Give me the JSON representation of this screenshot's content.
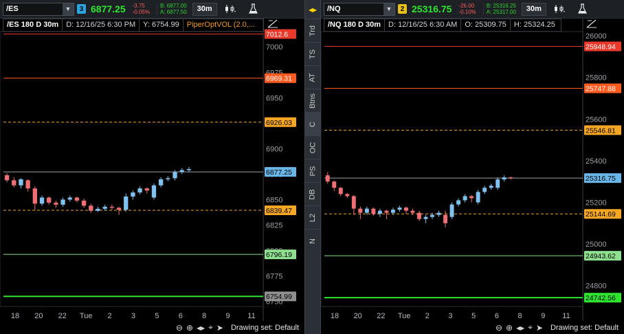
{
  "side_strip": {
    "tabs": [
      "Trd",
      "TS",
      "AT",
      "Btns",
      "C",
      "OC",
      "PS",
      "DB",
      "L2",
      "N"
    ]
  },
  "charts": [
    {
      "symbol": "/ES",
      "link_number": "3",
      "link_color": "#2aa7e0",
      "last": "6877.25",
      "net_change": "-3.75",
      "net_change_pct": "-0.05%",
      "bid": "B: 6877.00",
      "ask": "A: 6877.50",
      "timeframe": "30m",
      "info": {
        "symbol_period": "/ES 180 D 30m",
        "date": "D: 12/16/25 6:30 PM",
        "field": "Y: 6754.99",
        "study": "PiperOptVOL (2.0,..."
      },
      "axis_ticks": [
        "7000",
        "6975",
        "6950",
        "6925",
        "6900",
        "6875",
        "6850",
        "6825",
        "6800",
        "6775",
        "6750"
      ],
      "price_labels": [
        {
          "text": "7012.6",
          "bg": "#e8392b",
          "fg": "#ffffff"
        },
        {
          "text": "6969.31",
          "bg": "#ff5a1f",
          "fg": "#ffffff"
        },
        {
          "text": "6926.03",
          "bg": "#f5a623",
          "fg": "#000000"
        },
        {
          "text": "6877.25",
          "bg": "#6ab6e8",
          "fg": "#000000"
        },
        {
          "text": "6839.47",
          "bg": "#f5a623",
          "fg": "#000000"
        },
        {
          "text": "6796.19",
          "bg": "#8ee08e",
          "fg": "#000000"
        },
        {
          "text": "6754.99",
          "bg": "#8f8f8f",
          "fg": "#000000"
        }
      ],
      "x_labels": [
        "18",
        "20",
        "22",
        "Tue",
        "2",
        "3",
        "5",
        "6",
        "8",
        "9",
        "11"
      ],
      "drawing_set": "Drawing set: Default"
    },
    {
      "symbol": "/NQ",
      "link_number": "2",
      "link_color": "#e8c21a",
      "last": "25316.75",
      "net_change": "-26.00",
      "net_change_pct": "-0.10%",
      "bid": "B: 25316.25",
      "ask": "A: 25317.00",
      "timeframe": "30m",
      "info": {
        "symbol_period": "/NQ 180 D 30m",
        "date": "D: 12/16/25 6:30 AM",
        "field": "O: 25309.75",
        "study": "H: 25324.25"
      },
      "axis_ticks": [
        "26000",
        "25800",
        "25600",
        "25400",
        "25200",
        "25000",
        "24800"
      ],
      "price_labels": [
        {
          "text": "25948.94",
          "bg": "#e8392b",
          "fg": "#ffffff"
        },
        {
          "text": "25747.88",
          "bg": "#ff5a1f",
          "fg": "#ffffff"
        },
        {
          "text": "25546.81",
          "bg": "#f5a623",
          "fg": "#000000"
        },
        {
          "text": "25316.75",
          "bg": "#6ab6e8",
          "fg": "#000000"
        },
        {
          "text": "25144.69",
          "bg": "#f5a623",
          "fg": "#000000"
        },
        {
          "text": "24943.62",
          "bg": "#8ee08e",
          "fg": "#000000"
        },
        {
          "text": "24742.56",
          "bg": "#2ee52e",
          "fg": "#000000"
        }
      ],
      "x_labels": [
        "18",
        "20",
        "22",
        "Tue",
        "2",
        "3",
        "5",
        "6",
        "8",
        "9",
        "11"
      ],
      "drawing_set": "Drawing set: Default"
    }
  ],
  "chart_data": [
    {
      "type": "candlestick",
      "title": "/ES 180 D 30m",
      "ylim": [
        6745,
        7015
      ],
      "levels": [
        {
          "value": 7012.6,
          "color": "#e8392b",
          "style": "solid"
        },
        {
          "value": 6969.31,
          "color": "#ff5a1f",
          "style": "solid"
        },
        {
          "value": 6926.03,
          "color": "#f5a623",
          "style": "dashed"
        },
        {
          "value": 6877.25,
          "color": "#9aa0a6",
          "style": "solid"
        },
        {
          "value": 6839.47,
          "color": "#f5a623",
          "style": "dashed"
        },
        {
          "value": 6796.19,
          "color": "#8ee08e",
          "style": "solid"
        },
        {
          "value": 6754.99,
          "color": "#2ee52e",
          "style": "solid"
        }
      ],
      "candles": [
        [
          6874,
          6869,
          6876,
          6867
        ],
        [
          6869,
          6864,
          6872,
          6862
        ],
        [
          6864,
          6870,
          6871,
          6861
        ],
        [
          6869,
          6861,
          6870,
          6858
        ],
        [
          6861,
          6846,
          6863,
          6840
        ],
        [
          6846,
          6852,
          6854,
          6844
        ],
        [
          6852,
          6847,
          6853,
          6845
        ],
        [
          6847,
          6845,
          6849,
          6842
        ],
        [
          6845,
          6850,
          6852,
          6843
        ],
        [
          6850,
          6852,
          6854,
          6848
        ],
        [
          6852,
          6849,
          6853,
          6847
        ],
        [
          6849,
          6844,
          6851,
          6842
        ],
        [
          6844,
          6839,
          6846,
          6837
        ],
        [
          6839,
          6841,
          6843,
          6838
        ],
        [
          6841,
          6843,
          6845,
          6839
        ],
        [
          6843,
          6842,
          6845,
          6840
        ],
        [
          6842,
          6840,
          6843,
          6835
        ],
        [
          6840,
          6853,
          6856,
          6838
        ],
        [
          6853,
          6857,
          6859,
          6850
        ],
        [
          6857,
          6861,
          6863,
          6855
        ],
        [
          6861,
          6859,
          6862,
          6856
        ],
        [
          6852,
          6864,
          6866,
          6850
        ],
        [
          6864,
          6870,
          6872,
          6862
        ],
        [
          6870,
          6871,
          6873,
          6868
        ],
        [
          6871,
          6877,
          6879,
          6869
        ],
        [
          6877,
          6879,
          6881,
          6875
        ],
        [
          6879,
          6880,
          6882,
          6877
        ]
      ],
      "x_tick_labels": [
        "18",
        "20",
        "22",
        "Tue",
        "2",
        "3",
        "5",
        "6",
        "8",
        "9",
        "11"
      ]
    },
    {
      "type": "candlestick",
      "title": "/NQ 180 D 30m",
      "ylim": [
        24700,
        26020
      ],
      "levels": [
        {
          "value": 25948.94,
          "color": "#e8392b",
          "style": "solid"
        },
        {
          "value": 25747.88,
          "color": "#ff5a1f",
          "style": "solid"
        },
        {
          "value": 25546.81,
          "color": "#f5a623",
          "style": "dashed"
        },
        {
          "value": 25316.75,
          "color": "#9aa0a6",
          "style": "solid"
        },
        {
          "value": 25144.69,
          "color": "#f5a623",
          "style": "dashed"
        },
        {
          "value": 24943.62,
          "color": "#8ee08e",
          "style": "solid"
        },
        {
          "value": 24742.56,
          "color": "#2ee52e",
          "style": "solid"
        }
      ],
      "candles": [
        [
          25330,
          25300,
          25345,
          25290
        ],
        [
          25300,
          25270,
          25305,
          25255
        ],
        [
          25270,
          25240,
          25275,
          25230
        ],
        [
          25240,
          25230,
          25245,
          25220
        ],
        [
          25230,
          25170,
          25235,
          25140
        ],
        [
          25170,
          25150,
          25180,
          25120
        ],
        [
          25150,
          25170,
          25180,
          25140
        ],
        [
          25170,
          25145,
          25175,
          25135
        ],
        [
          25145,
          25160,
          25170,
          25130
        ],
        [
          25160,
          25150,
          25165,
          25120
        ],
        [
          25150,
          25165,
          25175,
          25140
        ],
        [
          25165,
          25175,
          25185,
          25155
        ],
        [
          25175,
          25160,
          25180,
          25145
        ],
        [
          25160,
          25150,
          25170,
          25140
        ],
        [
          25150,
          25120,
          25160,
          25110
        ],
        [
          25120,
          25130,
          25140,
          25100
        ],
        [
          25130,
          25140,
          25150,
          25120
        ],
        [
          25140,
          25150,
          25160,
          25130
        ],
        [
          25140,
          25100,
          25160,
          25080
        ],
        [
          25130,
          25190,
          25200,
          25120
        ],
        [
          25190,
          25210,
          25220,
          25180
        ],
        [
          25210,
          25230,
          25240,
          25200
        ],
        [
          25230,
          25220,
          25235,
          25200
        ],
        [
          25200,
          25250,
          25260,
          25190
        ],
        [
          25250,
          25270,
          25280,
          25240
        ],
        [
          25270,
          25280,
          25290,
          25260
        ],
        [
          25270,
          25310,
          25320,
          25260
        ],
        [
          25310,
          25320,
          25330,
          25300
        ],
        [
          25320,
          25316,
          25324,
          25310
        ]
      ],
      "x_tick_labels": [
        "18",
        "20",
        "22",
        "Tue",
        "2",
        "3",
        "5",
        "6",
        "8",
        "9",
        "11"
      ]
    }
  ]
}
